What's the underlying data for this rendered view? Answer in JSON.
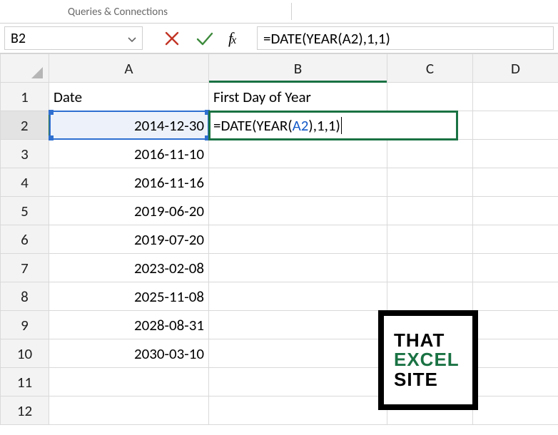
{
  "ribbon": {
    "tab_label": "Queries & Connections"
  },
  "namebox": {
    "value": "B2"
  },
  "formula_bar": {
    "fx_label": "fx",
    "formula": "=DATE(YEAR(A2),1,1)",
    "formula_pre": "=DATE(YEAR(",
    "formula_ref": "A2",
    "formula_post": "),1,1)"
  },
  "columns": [
    "A",
    "B",
    "C",
    "D"
  ],
  "row_numbers": [
    "1",
    "2",
    "3",
    "4",
    "5",
    "6",
    "7",
    "8",
    "9",
    "10",
    "11",
    "12"
  ],
  "headers": {
    "A": "Date",
    "B": "First Day of Year"
  },
  "dates": [
    "2014-12-30",
    "2016-11-10",
    "2016-11-16",
    "2019-06-20",
    "2019-07-20",
    "2023-02-08",
    "2025-11-08",
    "2028-08-31",
    "2030-03-10"
  ],
  "active_cell_text_pre": "=DATE(YEAR(",
  "active_cell_text_ref": "A2",
  "active_cell_text_post": "),1,1)",
  "logo": {
    "line1": "THAT",
    "line2": "EXCEL",
    "line3": "SITE"
  },
  "colors": {
    "accent_green": "#1a7243",
    "ref_blue": "#1158c7"
  }
}
